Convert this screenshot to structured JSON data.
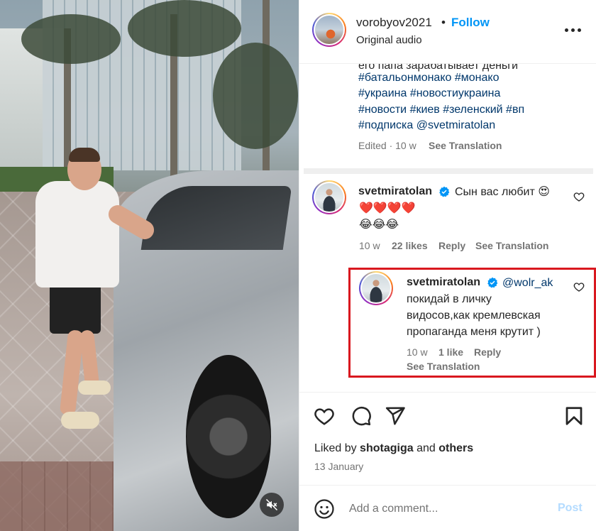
{
  "header": {
    "username": "vorobyov2021",
    "separator": "•",
    "follow_label": "Follow",
    "audio_label": "Original audio"
  },
  "caption": {
    "cut_line": "его папа зарабатывает деньги",
    "lines": [
      "#батальонмонако #монако",
      "#украина #новостиукраина",
      "#новости #киев #зеленский #вп",
      "#подписка @svetmiratolan"
    ],
    "edited": "Edited · 10 w",
    "see_translation": "See Translation"
  },
  "comments": [
    {
      "username": "svetmiratolan",
      "text_line1": "Сын вас любит 😍",
      "text_line2": "❤️❤️❤️❤️",
      "text_line3": "😂😂😂",
      "time": "10 w",
      "likes": "22 likes",
      "reply": "Reply",
      "see_translation": "See Translation"
    }
  ],
  "reply": {
    "username": "svetmiratolan",
    "mention": "@wolr_ak",
    "lines": [
      "покидай в личку",
      "видосов,как кремлевская",
      "пропаганда меня крутит )"
    ],
    "time": "10 w",
    "likes": "1 like",
    "reply": "Reply",
    "see_translation": "See Translation"
  },
  "footer": {
    "liked_prefix": "Liked by",
    "liked_user": "shotagiga",
    "liked_and": "and",
    "liked_others": "others",
    "date": "13 January",
    "comment_placeholder": "Add a comment...",
    "post_label": "Post"
  },
  "colors": {
    "follow_blue": "#0095f6",
    "hashtag": "#00376b",
    "highlight_red": "#d9181f",
    "muted_text": "#737373"
  },
  "icons": [
    "mute-icon",
    "more-icon",
    "verified-icon",
    "heart-icon",
    "comment-icon",
    "share-icon",
    "save-icon",
    "emoji-icon"
  ]
}
